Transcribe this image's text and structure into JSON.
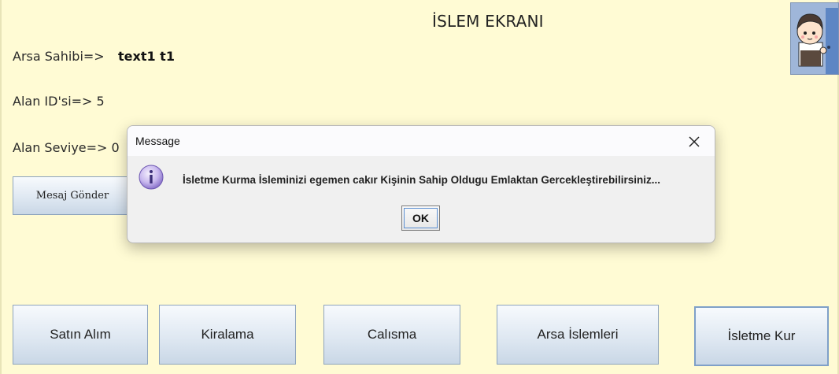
{
  "header": {
    "title": "İSLEM EKRANI"
  },
  "fields": {
    "owner_label": "Arsa Sahibi=>",
    "owner_value": "text1 t1",
    "area_id_label": "Alan ID'si=> 5",
    "area_level_label": "Alan Seviye=> 0"
  },
  "buttons": {
    "send_message": "Mesaj Gönder",
    "buy": "Satın Alım",
    "rent": "Kiralama",
    "work": "Calısma",
    "land_ops": "Arsa İslemleri",
    "business": "İsletme Kur"
  },
  "avatar": {
    "icon": "person-at-door-icon"
  },
  "dialog": {
    "title": "Message",
    "icon": "info-icon",
    "close_icon": "close-icon",
    "message": "İsletme Kurma İsleminizi egemen cakır Kişinin Sahip Oldugu Emlaktan Gercekleştirebilirsiniz...",
    "ok_label": "OK"
  }
}
